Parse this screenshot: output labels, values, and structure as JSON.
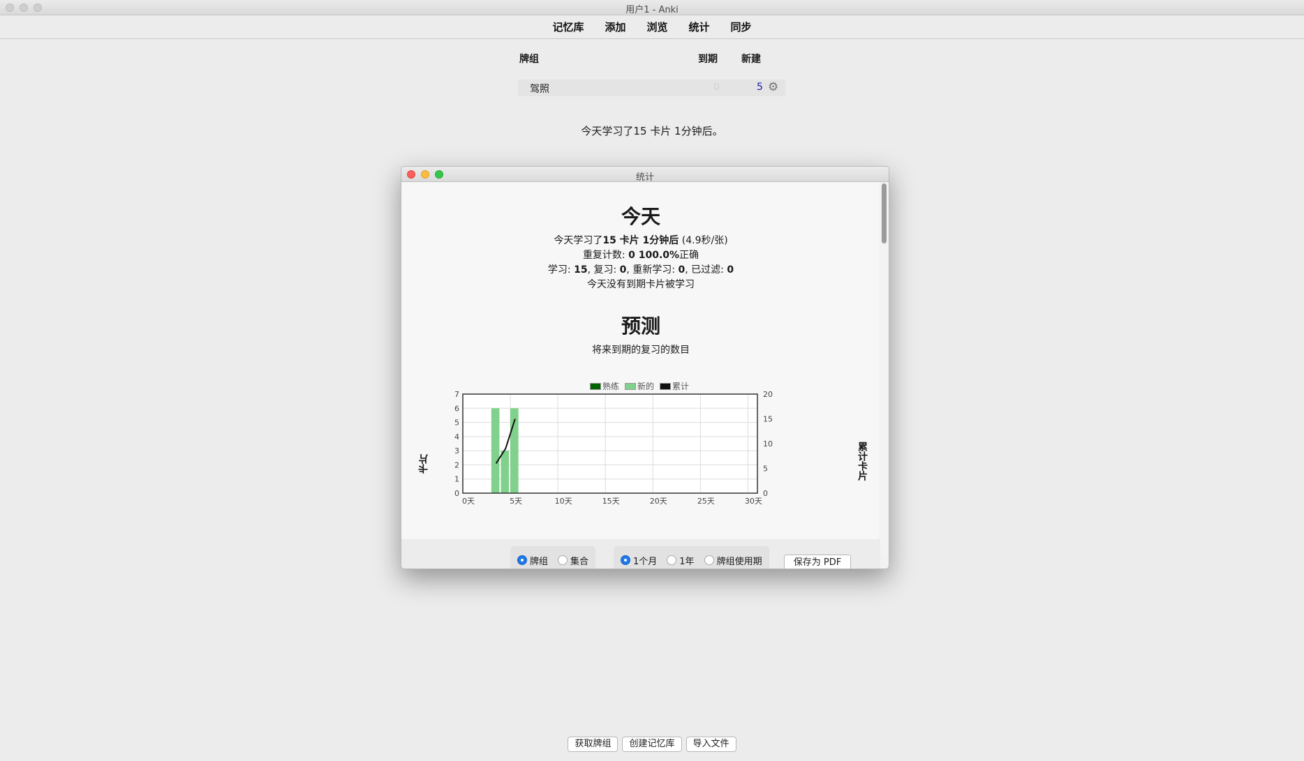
{
  "window": {
    "title": "用户1 - Anki"
  },
  "toolbar": {
    "items": [
      "记忆库",
      "添加",
      "浏览",
      "统计",
      "同步"
    ]
  },
  "deck_list": {
    "headers": {
      "deck": "牌组",
      "due": "到期",
      "new": "新建"
    },
    "rows": [
      {
        "name": "驾照",
        "due": "0",
        "new": "5"
      }
    ]
  },
  "study_summary": "今天学习了15 卡片 1分钟后。",
  "bottom_buttons": [
    "获取牌组",
    "创建记忆库",
    "导入文件"
  ],
  "stats": {
    "title": "统计",
    "today": {
      "heading": "今天",
      "line1_prefix": "今天学习了",
      "line1_bold": "15 卡片 1分钟后",
      "line1_suffix": " (4.9秒/张)",
      "line2_prefix": "重复计数: ",
      "line2_bold": "0 100.0%",
      "line2_suffix": "正确",
      "line3": {
        "learn_label": "学习: ",
        "learn": "15",
        "review_label": ", 复习: ",
        "review": "0",
        "relearn_label": ", 重新学习: ",
        "relearn": "0",
        "filtered_label": ", 已过滤: ",
        "filtered": "0"
      },
      "line4": "今天没有到期卡片被学习"
    },
    "forecast": {
      "heading": "预测",
      "subtitle": "将来到期的复习的数目"
    },
    "options": {
      "scope": [
        "牌组",
        "集合"
      ],
      "scope_selected": 0,
      "period": [
        "1个月",
        "1年",
        "牌组使用期"
      ],
      "period_selected": 0,
      "save_pdf": "保存为 PDF"
    }
  },
  "chart_data": {
    "type": "bar",
    "legend": [
      {
        "name": "熟练",
        "color": "#006400"
      },
      {
        "name": "新的",
        "color": "#7fd18b"
      },
      {
        "name": "累计",
        "color": "#111111"
      }
    ],
    "ylabel": "卡片",
    "y2label": "累计卡片",
    "xlim": [
      0,
      31
    ],
    "ylim": [
      0,
      7
    ],
    "y2lim": [
      0,
      20
    ],
    "x_ticks": [
      "0天",
      "5天",
      "10天",
      "15天",
      "20天",
      "25天",
      "30天"
    ],
    "x_tick_values": [
      0,
      5,
      10,
      15,
      20,
      25,
      30
    ],
    "y_ticks": [
      0,
      1,
      2,
      3,
      4,
      5,
      6,
      7
    ],
    "y2_ticks": [
      0,
      5,
      10,
      15,
      20
    ],
    "series": [
      {
        "name": "新的",
        "x": [
          3,
          4,
          5
        ],
        "values": [
          6,
          3,
          6
        ]
      }
    ],
    "cumulative": {
      "name": "累计",
      "x": [
        3.5,
        4.5,
        5.5
      ],
      "values": [
        6,
        9,
        15
      ]
    }
  }
}
